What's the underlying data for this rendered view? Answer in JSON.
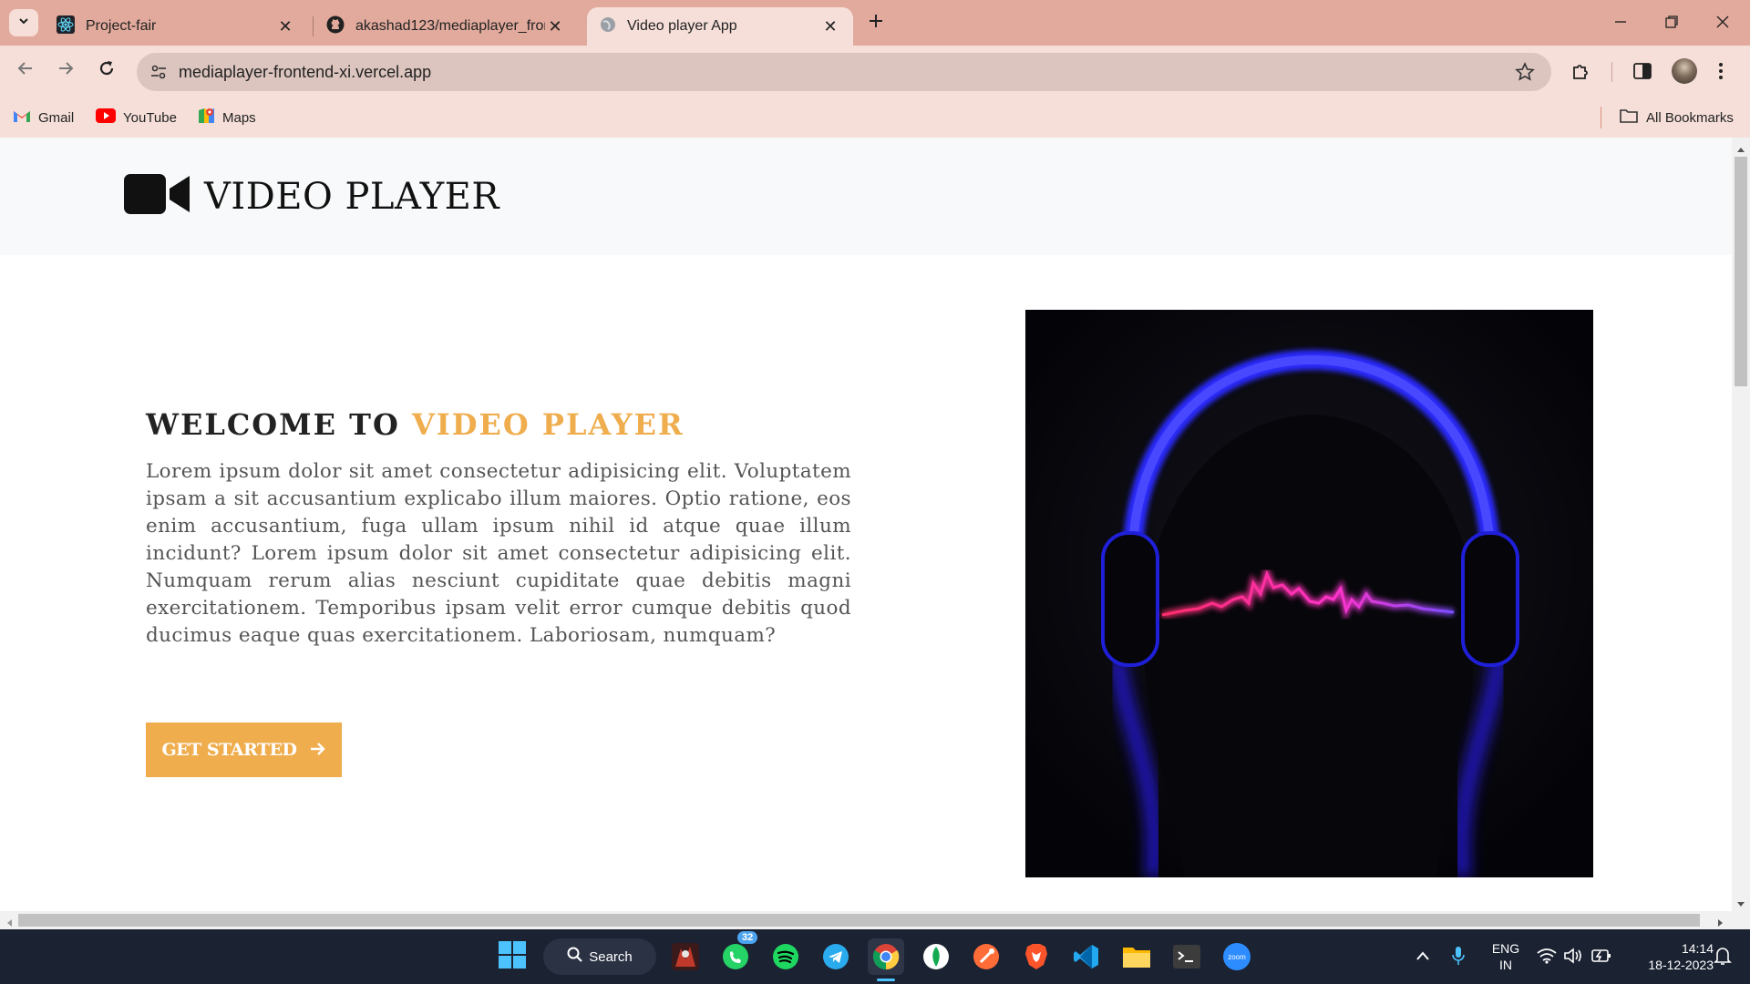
{
  "browser": {
    "tabs": [
      {
        "title": "Project-fair",
        "icon": "react-icon"
      },
      {
        "title": "akashad123/mediaplayer_fronte",
        "icon": "github-icon"
      },
      {
        "title": "Video player App",
        "icon": "globe-icon"
      }
    ],
    "url": "mediaplayer-frontend-xi.vercel.app",
    "bookmarks": [
      {
        "label": "Gmail",
        "icon": "gmail-icon"
      },
      {
        "label": "YouTube",
        "icon": "youtube-icon"
      },
      {
        "label": "Maps",
        "icon": "maps-icon"
      }
    ],
    "all_bookmarks": "All Bookmarks"
  },
  "site": {
    "brand": "VIDEO PLAYER",
    "hero": {
      "title_prefix": "WELCOME TO ",
      "title_highlight": "VIDEO PLAYER",
      "text": "Lorem ipsum dolor sit amet consectetur adipisicing elit. Voluptatem ipsam a sit accusantium explicabo illum maiores. Optio ratione, eos enim accusantium, fuga ullam ipsum nihil id atque quae illum incidunt? Lorem ipsum dolor sit amet consectetur adipisicing elit. Numquam rerum alias nesciunt cupiditate quae debitis magni exercitationem. Temporibus ipsam velit error cumque debitis quod ducimus eaque quas exercitationem. Laboriosam, numquam?",
      "cta": "GET STARTED"
    },
    "accent_color": "#efad4d"
  },
  "taskbar": {
    "search": "Search",
    "whatsapp_badge": "32",
    "zoom_label": "zoom",
    "lang_top": "ENG",
    "lang_bottom": "IN",
    "time": "14:14",
    "date": "18-12-2023"
  }
}
